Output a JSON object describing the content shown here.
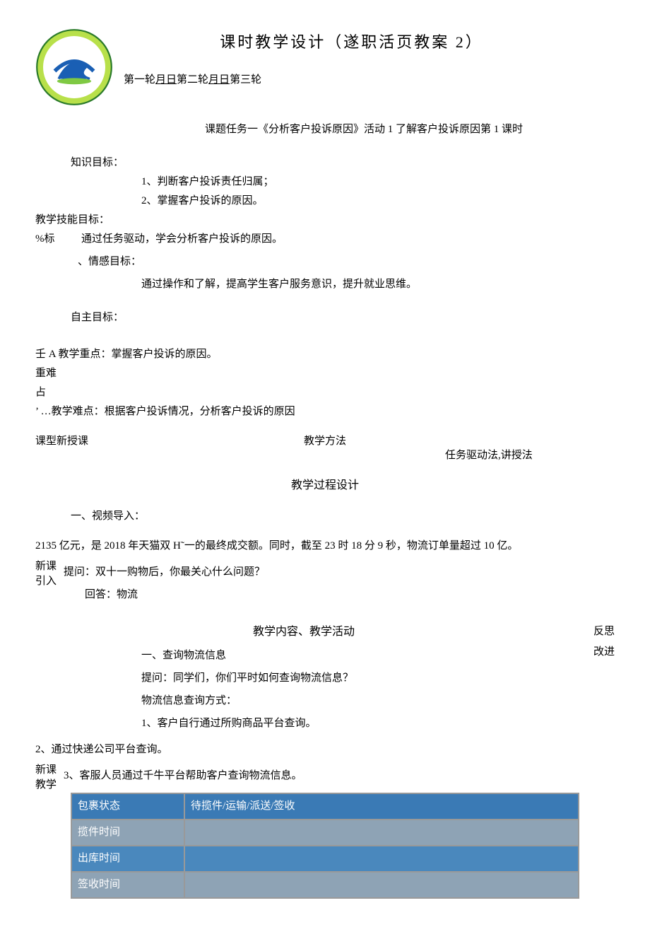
{
  "header": {
    "main_title": "课时教学设计（遂职活页教案 2）",
    "rounds_text_1": "第一轮",
    "rounds_underline_1": "月日",
    "rounds_text_2": "第二轮",
    "rounds_underline_2": "月日",
    "rounds_text_3": "第三轮"
  },
  "topic": "课题任务一《分析客户投诉原因》活动 1 了解客户投诉原因第 1 课时",
  "objectives": {
    "knowledge_label": "知识目标：",
    "knowledge_1": "1、判断客户投诉责任归属；",
    "knowledge_2": "2、掌握客户投诉的原因。",
    "skill_label_left": "教学技能目标：",
    "percent_label": "%标",
    "skill_content": "通过任务驱动，学会分析客户投诉的原因。",
    "emotion_label": "、情感目标：",
    "emotion_content": "通过操作和了解，提高学生客户服务意识，提升就业思维。",
    "self_label": "自主目标："
  },
  "key_points": {
    "line1_prefix": "壬 A 教学重点：掌握客户投诉的原因。",
    "line2": "重难",
    "line3": "占",
    "line4": "’ …教学难点：根据客户投诉情况，分析客户投诉的原因"
  },
  "meta": {
    "class_type_label": "课型新授课",
    "method_label": "教学方法",
    "method_value": "任务驱动法,讲授法"
  },
  "process_title": "教学过程设计",
  "intro": {
    "section_1": "一、视频导入：",
    "paragraph": "2135 亿元，是 2018 年天猫双 H˜一的最终成交额。同时，截至 23 时 18 分 9 秒，物流订单量超过 10 亿。",
    "side_label_1": "新课",
    "side_label_2": "引入",
    "question": "提问：双十一购物后，你最关心什么问题？",
    "answer": "回答：物流"
  },
  "activity": {
    "title": "教学内容、教学活动",
    "reflect_1": "反思",
    "reflect_2": "改进",
    "sec1": "一、查询物流信息",
    "q1": "提问：同学们，你们平时如何查询物流信息？",
    "q2": "物流信息查询方式：",
    "item1": "1、客户自行通过所购商品平台查询。",
    "item2": "2、通过快递公司平台查询。",
    "side_label_1": "新课",
    "side_label_2": "教学",
    "item3": "3、客服人员通过千牛平台帮助客户查询物流信息。"
  },
  "table": {
    "header_col1": "包裹状态",
    "header_col2": "待揽件/运输/派送/签收",
    "row1_col1": "揽件时间",
    "row2_col1": "出库时间",
    "row3_col1": "签收时间"
  }
}
